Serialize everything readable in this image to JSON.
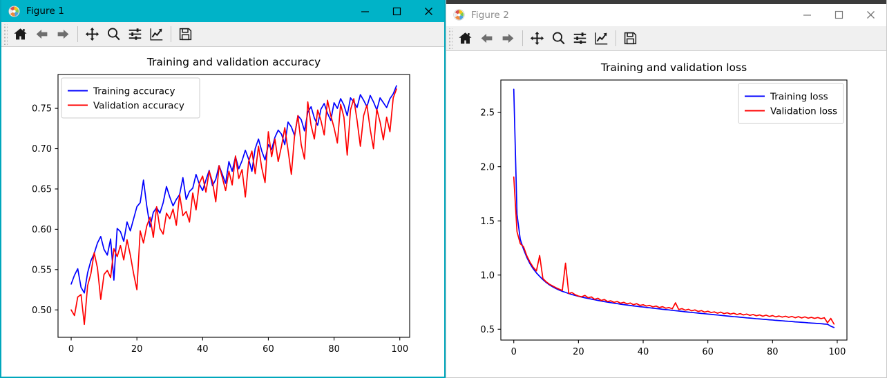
{
  "windows": [
    {
      "id": "figure-1",
      "title": "Figure 1",
      "active": true,
      "accent": "#00B3C8",
      "controls": {
        "minimize": "—",
        "maximize": "□",
        "close": "✕"
      },
      "toolbar": [
        {
          "name": "home-icon",
          "tooltip": "Reset original view"
        },
        {
          "name": "back-arrow-icon",
          "tooltip": "Back to previous view"
        },
        {
          "name": "forward-arrow-icon",
          "tooltip": "Forward to next view"
        },
        {
          "name": "separator",
          "tooltip": ""
        },
        {
          "name": "pan-move-icon",
          "tooltip": "Pan axes with left mouse, zoom with right"
        },
        {
          "name": "zoom-magnifier-icon",
          "tooltip": "Zoom to rectangle"
        },
        {
          "name": "subplot-sliders-icon",
          "tooltip": "Configure subplots"
        },
        {
          "name": "edit-curve-icon",
          "tooltip": "Edit axis, curve and image parameters"
        },
        {
          "name": "separator",
          "tooltip": ""
        },
        {
          "name": "save-floppy-icon",
          "tooltip": "Save the figure"
        }
      ]
    },
    {
      "id": "figure-2",
      "title": "Figure 2",
      "active": false,
      "accent": "#ffffff",
      "controls": {
        "minimize": "—",
        "maximize": "□",
        "close": "✕"
      },
      "toolbar": [
        {
          "name": "home-icon",
          "tooltip": "Reset original view"
        },
        {
          "name": "back-arrow-icon",
          "tooltip": "Back to previous view"
        },
        {
          "name": "forward-arrow-icon",
          "tooltip": "Forward to next view"
        },
        {
          "name": "separator",
          "tooltip": ""
        },
        {
          "name": "pan-move-icon",
          "tooltip": "Pan axes with left mouse, zoom with right"
        },
        {
          "name": "zoom-magnifier-icon",
          "tooltip": "Zoom to rectangle"
        },
        {
          "name": "subplot-sliders-icon",
          "tooltip": "Configure subplots"
        },
        {
          "name": "edit-curve-icon",
          "tooltip": "Edit axis, curve and image parameters"
        },
        {
          "name": "separator",
          "tooltip": ""
        },
        {
          "name": "save-floppy-icon",
          "tooltip": "Save the figure"
        }
      ]
    }
  ],
  "chart_data": [
    {
      "type": "line",
      "title": "Training and validation accuracy",
      "xlabel": "",
      "ylabel": "",
      "grid": false,
      "legend_position": "upper left",
      "xlim": [
        -4,
        103
      ],
      "ylim": [
        0.466,
        0.792
      ],
      "xticks": [
        0,
        20,
        40,
        60,
        80,
        100
      ],
      "yticks": [
        0.5,
        0.55,
        0.6,
        0.65,
        0.7,
        0.75
      ],
      "ytick_labels": [
        "0.50",
        "0.55",
        "0.60",
        "0.65",
        "0.70",
        "0.75"
      ],
      "xtick_labels": [
        "0",
        "20",
        "40",
        "60",
        "80",
        "100"
      ],
      "x": [
        0,
        1,
        2,
        3,
        4,
        5,
        6,
        7,
        8,
        9,
        10,
        11,
        12,
        13,
        14,
        15,
        16,
        17,
        18,
        19,
        20,
        21,
        22,
        23,
        24,
        25,
        26,
        27,
        28,
        29,
        30,
        31,
        32,
        33,
        34,
        35,
        36,
        37,
        38,
        39,
        40,
        41,
        42,
        43,
        44,
        45,
        46,
        47,
        48,
        49,
        50,
        51,
        52,
        53,
        54,
        55,
        56,
        57,
        58,
        59,
        60,
        61,
        62,
        63,
        64,
        65,
        66,
        67,
        68,
        69,
        70,
        71,
        72,
        73,
        74,
        75,
        76,
        77,
        78,
        79,
        80,
        81,
        82,
        83,
        84,
        85,
        86,
        87,
        88,
        89,
        90,
        91,
        92,
        93,
        94,
        95,
        96,
        97,
        98,
        99
      ],
      "series": [
        {
          "name": "Training accuracy",
          "color": "#0000FF",
          "values": [
            0.532,
            0.543,
            0.551,
            0.528,
            0.521,
            0.546,
            0.561,
            0.57,
            0.583,
            0.591,
            0.575,
            0.568,
            0.588,
            0.537,
            0.601,
            0.597,
            0.585,
            0.609,
            0.598,
            0.613,
            0.628,
            0.633,
            0.661,
            0.629,
            0.603,
            0.621,
            0.627,
            0.62,
            0.633,
            0.653,
            0.64,
            0.629,
            0.637,
            0.643,
            0.664,
            0.637,
            0.647,
            0.651,
            0.668,
            0.656,
            0.648,
            0.661,
            0.673,
            0.654,
            0.662,
            0.679,
            0.668,
            0.657,
            0.684,
            0.672,
            0.69,
            0.675,
            0.685,
            0.698,
            0.687,
            0.672,
            0.7,
            0.712,
            0.697,
            0.686,
            0.705,
            0.699,
            0.714,
            0.723,
            0.718,
            0.705,
            0.733,
            0.727,
            0.716,
            0.741,
            0.736,
            0.722,
            0.745,
            0.752,
            0.738,
            0.729,
            0.749,
            0.756,
            0.744,
            0.735,
            0.757,
            0.75,
            0.762,
            0.754,
            0.741,
            0.763,
            0.758,
            0.751,
            0.767,
            0.76,
            0.752,
            0.766,
            0.758,
            0.748,
            0.763,
            0.757,
            0.751,
            0.762,
            0.768,
            0.778
          ]
        },
        {
          "name": "Validation accuracy",
          "color": "#FF0000",
          "values": [
            0.5,
            0.493,
            0.516,
            0.519,
            0.482,
            0.53,
            0.545,
            0.571,
            0.552,
            0.513,
            0.544,
            0.549,
            0.54,
            0.576,
            0.566,
            0.58,
            0.562,
            0.587,
            0.568,
            0.545,
            0.525,
            0.598,
            0.583,
            0.604,
            0.615,
            0.59,
            0.628,
            0.601,
            0.594,
            0.62,
            0.613,
            0.625,
            0.605,
            0.643,
            0.617,
            0.622,
            0.609,
            0.645,
            0.624,
            0.657,
            0.666,
            0.646,
            0.672,
            0.659,
            0.634,
            0.679,
            0.664,
            0.648,
            0.672,
            0.655,
            0.691,
            0.663,
            0.674,
            0.64,
            0.684,
            0.697,
            0.669,
            0.703,
            0.676,
            0.658,
            0.721,
            0.69,
            0.712,
            0.684,
            0.703,
            0.726,
            0.698,
            0.668,
            0.717,
            0.741,
            0.705,
            0.687,
            0.758,
            0.729,
            0.712,
            0.748,
            0.735,
            0.717,
            0.76,
            0.741,
            0.726,
            0.707,
            0.755,
            0.739,
            0.692,
            0.748,
            0.762,
            0.735,
            0.703,
            0.741,
            0.754,
            0.724,
            0.7,
            0.749,
            0.733,
            0.711,
            0.739,
            0.721,
            0.763,
            0.774
          ]
        }
      ]
    },
    {
      "type": "line",
      "title": "Training and validation loss",
      "xlabel": "",
      "ylabel": "",
      "grid": false,
      "legend_position": "upper right",
      "xlim": [
        -4,
        103
      ],
      "ylim": [
        0.4,
        2.8
      ],
      "xticks": [
        0,
        20,
        40,
        60,
        80,
        100
      ],
      "yticks": [
        0.5,
        1.0,
        1.5,
        2.0,
        2.5
      ],
      "ytick_labels": [
        "0.5",
        "1.0",
        "1.5",
        "2.0",
        "2.5"
      ],
      "xtick_labels": [
        "0",
        "20",
        "40",
        "60",
        "80",
        "100"
      ],
      "x": [
        0,
        1,
        2,
        3,
        4,
        5,
        6,
        7,
        8,
        9,
        10,
        11,
        12,
        13,
        14,
        15,
        16,
        17,
        18,
        19,
        20,
        21,
        22,
        23,
        24,
        25,
        26,
        27,
        28,
        29,
        30,
        31,
        32,
        33,
        34,
        35,
        36,
        37,
        38,
        39,
        40,
        41,
        42,
        43,
        44,
        45,
        46,
        47,
        48,
        49,
        50,
        51,
        52,
        53,
        54,
        55,
        56,
        57,
        58,
        59,
        60,
        61,
        62,
        63,
        64,
        65,
        66,
        67,
        68,
        69,
        70,
        71,
        72,
        73,
        74,
        75,
        76,
        77,
        78,
        79,
        80,
        81,
        82,
        83,
        84,
        85,
        86,
        87,
        88,
        89,
        90,
        91,
        92,
        93,
        94,
        95,
        96,
        97,
        98,
        99
      ],
      "series": [
        {
          "name": "Training loss",
          "color": "#0000FF",
          "values": [
            2.715,
            1.56,
            1.33,
            1.24,
            1.165,
            1.105,
            1.058,
            1.02,
            0.988,
            0.958,
            0.932,
            0.91,
            0.892,
            0.876,
            0.862,
            0.85,
            0.84,
            0.829,
            0.82,
            0.812,
            0.804,
            0.797,
            0.79,
            0.784,
            0.778,
            0.772,
            0.766,
            0.76,
            0.755,
            0.75,
            0.745,
            0.74,
            0.736,
            0.731,
            0.727,
            0.723,
            0.719,
            0.715,
            0.712,
            0.708,
            0.705,
            0.701,
            0.698,
            0.694,
            0.691,
            0.688,
            0.684,
            0.681,
            0.678,
            0.674,
            0.671,
            0.668,
            0.665,
            0.661,
            0.658,
            0.655,
            0.652,
            0.649,
            0.646,
            0.643,
            0.64,
            0.637,
            0.634,
            0.631,
            0.628,
            0.625,
            0.622,
            0.619,
            0.616,
            0.614,
            0.611,
            0.608,
            0.605,
            0.603,
            0.6,
            0.597,
            0.595,
            0.592,
            0.59,
            0.587,
            0.585,
            0.582,
            0.58,
            0.578,
            0.575,
            0.573,
            0.571,
            0.568,
            0.566,
            0.564,
            0.562,
            0.559,
            0.557,
            0.555,
            0.553,
            0.551,
            0.548,
            0.546,
            0.528,
            0.516
          ]
        },
        {
          "name": "Validation loss",
          "color": "#FF0000",
          "values": [
            1.905,
            1.4,
            1.29,
            1.262,
            1.18,
            1.12,
            1.072,
            1.038,
            1.18,
            0.968,
            0.938,
            0.916,
            0.9,
            0.884,
            0.87,
            0.858,
            1.11,
            0.83,
            0.838,
            0.818,
            0.806,
            0.8,
            0.812,
            0.79,
            0.798,
            0.776,
            0.786,
            0.766,
            0.774,
            0.756,
            0.762,
            0.748,
            0.756,
            0.74,
            0.748,
            0.734,
            0.742,
            0.726,
            0.736,
            0.72,
            0.726,
            0.714,
            0.72,
            0.706,
            0.714,
            0.7,
            0.708,
            0.694,
            0.7,
            0.688,
            0.744,
            0.682,
            0.69,
            0.676,
            0.684,
            0.67,
            0.678,
            0.664,
            0.672,
            0.658,
            0.666,
            0.654,
            0.66,
            0.648,
            0.658,
            0.644,
            0.652,
            0.64,
            0.648,
            0.636,
            0.644,
            0.632,
            0.64,
            0.628,
            0.636,
            0.624,
            0.632,
            0.62,
            0.63,
            0.618,
            0.626,
            0.614,
            0.622,
            0.612,
            0.62,
            0.61,
            0.618,
            0.606,
            0.616,
            0.604,
            0.614,
            0.602,
            0.61,
            0.6,
            0.608,
            0.598,
            0.606,
            0.56,
            0.6,
            0.548
          ]
        }
      ]
    }
  ]
}
